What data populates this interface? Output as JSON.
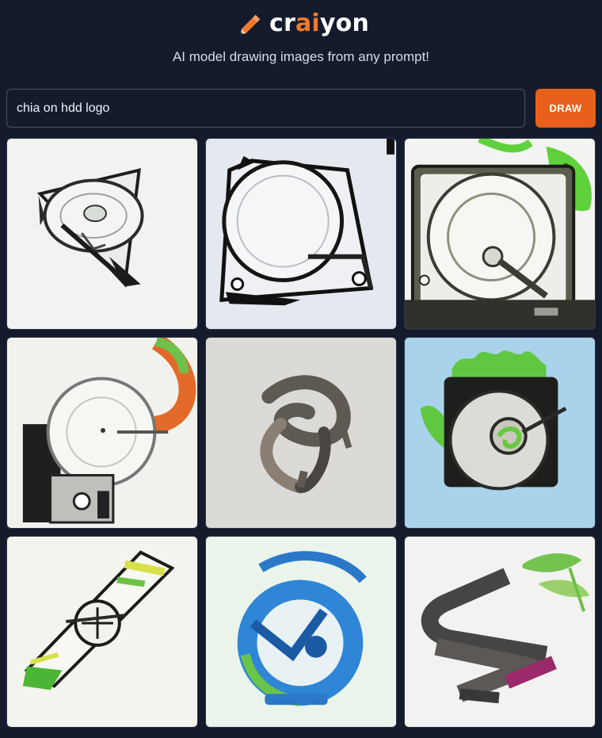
{
  "brand": {
    "name_prefix": "cr",
    "name_accent": "ai",
    "name_suffix": "yon",
    "accent_color": "#f07a2e",
    "icon": "pencil-icon"
  },
  "tagline": "AI model drawing images from any prompt!",
  "prompt": {
    "value": "chia on hdd logo"
  },
  "draw_button": {
    "label": "DRAW",
    "color": "#e8601c"
  },
  "results": [
    {
      "name": "generated-image-1",
      "description": "sketch of hard drive platter in triangle"
    },
    {
      "name": "generated-image-2",
      "description": "hard drive platter in white triangular frame"
    },
    {
      "name": "generated-image-3",
      "description": "hard drive with green leaf"
    },
    {
      "name": "generated-image-4",
      "description": "hard drive with colorful swoosh"
    },
    {
      "name": "generated-image-5",
      "description": "abstract grey swirl logo"
    },
    {
      "name": "generated-image-6",
      "description": "hard drive with green sprouts on blue"
    },
    {
      "name": "generated-image-7",
      "description": "angled drive with green and yellow"
    },
    {
      "name": "generated-image-8",
      "description": "blue and green circular logo"
    },
    {
      "name": "generated-image-9",
      "description": "grey chevron logo with green leaves"
    }
  ]
}
